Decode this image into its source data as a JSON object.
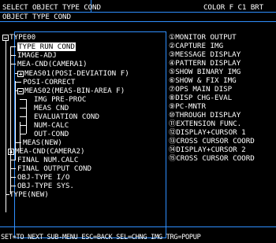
{
  "header": {
    "title": "SELECT OBJECT TYPE COND",
    "right": "COLOR F  C1 BRT"
  },
  "subtitle": "OBJECT TYPE COND",
  "tree": [
    {
      "label": "TYPE00"
    },
    {
      "label": "TYPE RUN COND"
    },
    {
      "label": "IMAGE-ADJ"
    },
    {
      "label": "MEA-CND(CAMERA1)"
    },
    {
      "label": "MEAS01(POSI-DEVIATION F)"
    },
    {
      "label": "POSI-CORRECT"
    },
    {
      "label": "MEAS02(MEAS-BIN-AREA F)"
    },
    {
      "label": "IMG PRE-PROC"
    },
    {
      "label": "MEAS CND"
    },
    {
      "label": "EVALUATION COND"
    },
    {
      "label": "NUM-CALC"
    },
    {
      "label": "OUT-COND"
    },
    {
      "label": "MEAS(NEW)"
    },
    {
      "label": "MEA-CND(CAMERA2)"
    },
    {
      "label": "FINAL NUM.CALC"
    },
    {
      "label": "FINAL OUTPUT COND"
    },
    {
      "label": "OBJ-TYPE I/O"
    },
    {
      "label": "OBJ-TYPE SYS."
    },
    {
      "label": "TYPE(NEW)"
    }
  ],
  "menu": [
    {
      "num": "①",
      "label": "MONITOR OUTPUT"
    },
    {
      "num": "②",
      "label": "CAPTURE IMG"
    },
    {
      "num": "③",
      "label": "MESSAGE DISPLAY"
    },
    {
      "num": "④",
      "label": "PATTERN DISPLAY"
    },
    {
      "num": "⑤",
      "label": "SHOW BINARY IMG"
    },
    {
      "num": "⑥",
      "label": "SHOW & FIX IMG"
    },
    {
      "num": "⑦",
      "label": "OPS MAIN DISP"
    },
    {
      "num": "⑧",
      "label": "DISP CHG-EVAL"
    },
    {
      "num": "⑨",
      "label": "PC-MNTR"
    },
    {
      "num": "⑩",
      "label": "THROUGH DISPLAY"
    },
    {
      "num": "⑪",
      "label": "EXTENSION FUNC."
    },
    {
      "num": "⑫",
      "label": "DISPLAY+CURSOR 1"
    },
    {
      "num": "⑬",
      "label": "CROSS CURSOR COORD"
    },
    {
      "num": "⑭",
      "label": "DISPLAY+CURSOR 2"
    },
    {
      "num": "⑮",
      "label": "CROSS CURSOR COORD"
    }
  ],
  "footer": "SET=TO NEXT SUB-MENU ESC=BACK SEL=CHNG IMG TRG=POPUP",
  "colors": {
    "accent": "#2f8fff",
    "background": "#000000",
    "text": "#ffffff"
  }
}
